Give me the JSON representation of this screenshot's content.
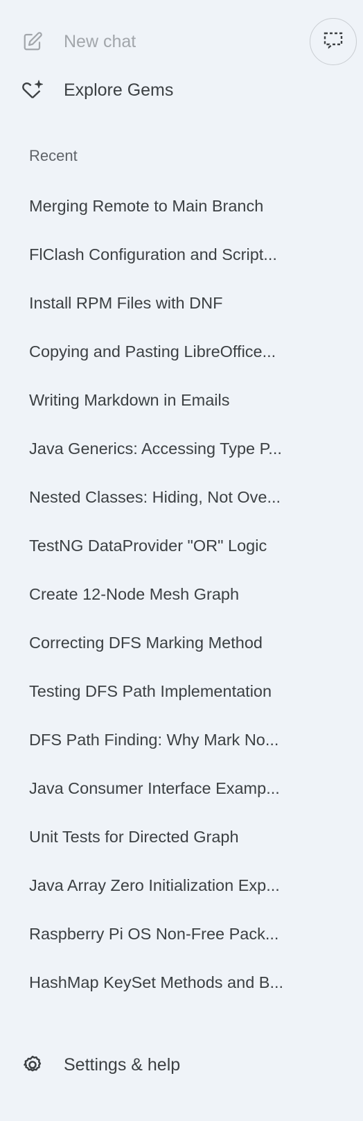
{
  "nav": {
    "new_chat": {
      "label": "New chat",
      "icon": "edit-icon"
    },
    "explore_gems": {
      "label": "Explore Gems",
      "icon": "gem-icon"
    }
  },
  "toolbar": {
    "toggle_icon": "chat-window-toggle-icon"
  },
  "recent": {
    "heading": "Recent",
    "items": [
      {
        "label": "Merging Remote to Main Branch"
      },
      {
        "label": "FlClash Configuration and Script..."
      },
      {
        "label": "Install RPM Files with DNF"
      },
      {
        "label": "Copying and Pasting LibreOffice..."
      },
      {
        "label": "Writing Markdown in Emails"
      },
      {
        "label": "Java Generics: Accessing Type P..."
      },
      {
        "label": "Nested Classes: Hiding, Not Ove..."
      },
      {
        "label": "TestNG DataProvider \"OR\" Logic"
      },
      {
        "label": "Create 12-Node Mesh Graph"
      },
      {
        "label": "Correcting DFS Marking Method"
      },
      {
        "label": "Testing DFS Path Implementation"
      },
      {
        "label": "DFS Path Finding: Why Mark No..."
      },
      {
        "label": "Java Consumer Interface Examp..."
      },
      {
        "label": "Unit Tests for Directed Graph"
      },
      {
        "label": "Java Array Zero Initialization Exp..."
      },
      {
        "label": "Raspberry Pi OS Non-Free Pack..."
      },
      {
        "label": "HashMap KeySet Methods and B..."
      }
    ]
  },
  "footer": {
    "settings": {
      "label": "Settings & help",
      "icon": "gear-icon"
    }
  },
  "colors": {
    "background": "#eff3f8",
    "text_primary": "#3c4043",
    "text_muted": "#a2a6ab",
    "text_secondary": "#5f6368"
  }
}
